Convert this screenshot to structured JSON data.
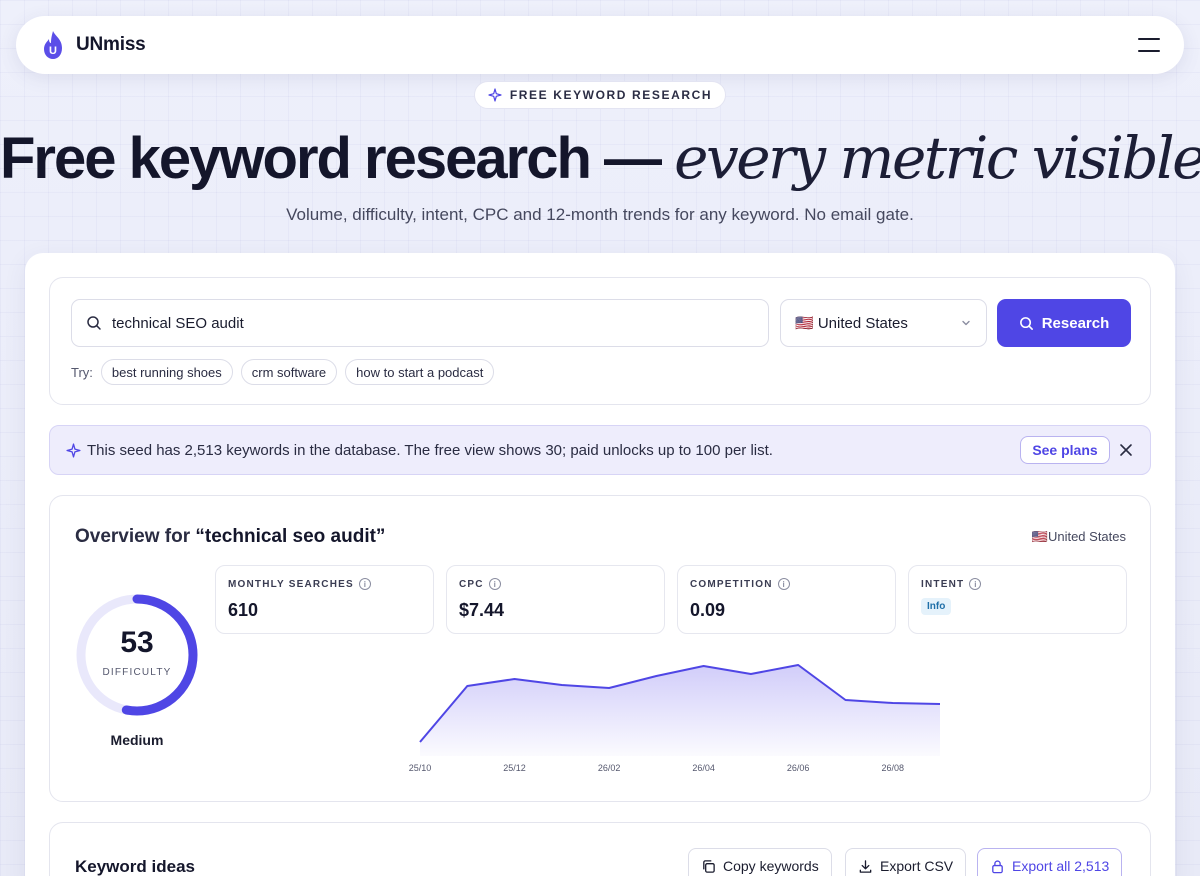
{
  "nav": {
    "brand": "UNmiss",
    "logo_letter": "U"
  },
  "hero": {
    "eyebrow": "FREE KEYWORD RESEARCH",
    "title_main": "Free keyword research — ",
    "title_italic": "every metric visible.",
    "subtitle": "Volume, difficulty, intent, CPC and 12-month trends for any keyword. No email gate."
  },
  "search": {
    "value": "technical SEO audit",
    "country": "🇺🇸 United States",
    "button": "Research",
    "try_label": "Try:",
    "suggestions": [
      "best running shoes",
      "crm software",
      "how to start a podcast"
    ]
  },
  "notice": {
    "text": "This seed has 2,513 keywords in the database. The free view shows 30; paid unlocks up to 100 per list.",
    "cta": "See plans"
  },
  "overview": {
    "title_prefix": "Overview for ",
    "query": "“technical seo audit”",
    "country": "🇺🇸United States",
    "difficulty": {
      "value": "53",
      "label": "DIFFICULTY",
      "level": "Medium",
      "fraction": 0.53
    },
    "metrics": [
      {
        "label": "MONTHLY SEARCHES",
        "value": "610"
      },
      {
        "label": "CPC",
        "value": "$7.44"
      },
      {
        "label": "COMPETITION",
        "value": "0.09"
      },
      {
        "label": "INTENT",
        "badge": "Info"
      }
    ]
  },
  "chart_data": {
    "type": "area",
    "x": [
      "25/10",
      "25/11",
      "25/12",
      "26/01",
      "26/02",
      "26/03",
      "26/04",
      "26/05",
      "26/06",
      "26/07",
      "26/08",
      "26/09"
    ],
    "tick_labels": [
      "25/10",
      "25/12",
      "26/02",
      "26/04",
      "26/06",
      "26/08"
    ],
    "values": [
      420,
      700,
      735,
      705,
      690,
      750,
      800,
      760,
      805,
      630,
      615,
      610
    ],
    "ylim": [
      400,
      900
    ],
    "color": "#4f46e5"
  },
  "ideas": {
    "title": "Keyword ideas",
    "copy": "Copy keywords",
    "export_csv": "Export CSV",
    "export_all": "Export all 2,513"
  }
}
